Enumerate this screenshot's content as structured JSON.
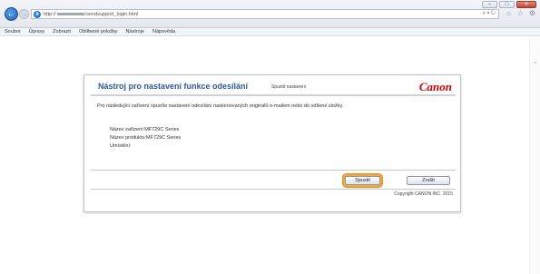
{
  "browser": {
    "url_prefix": "http://",
    "url_suffix": "/sendsupport_login.html",
    "search_glyph": "⌕ ▾ ↻",
    "window_controls": {
      "minimize": "–",
      "maximize": "□",
      "close": "×"
    },
    "toolbar_icons": [
      "home-icon",
      "favorites-star-icon",
      "settings-gear-icon"
    ]
  },
  "menubar": {
    "items": [
      "Soubor",
      "Úpravy",
      "Zobrazit",
      "Oblíbené položky",
      "Nástroje",
      "Nápověda"
    ]
  },
  "panel": {
    "title": "Nástroj pro nastavení funkce odesílání",
    "subtitle": "Spustit nastavení",
    "brand": "Canon",
    "instruction": "Pro následující zařízení spusťte nastavení odesílání naskenovaných originálů e-mailem nebo do sdílené složky.",
    "device_name": "Název zařízení:MF729C Series",
    "product_name": "Název produktu:MF729C Series",
    "location": "Umístění:",
    "start_button": "Spustit",
    "back_button": "Zrušit",
    "copyright": "Copyright CANON INC. 2015"
  },
  "colors": {
    "title": "#2c5aa0",
    "brand": "#cc0000",
    "highlight": "#f3a73c"
  }
}
